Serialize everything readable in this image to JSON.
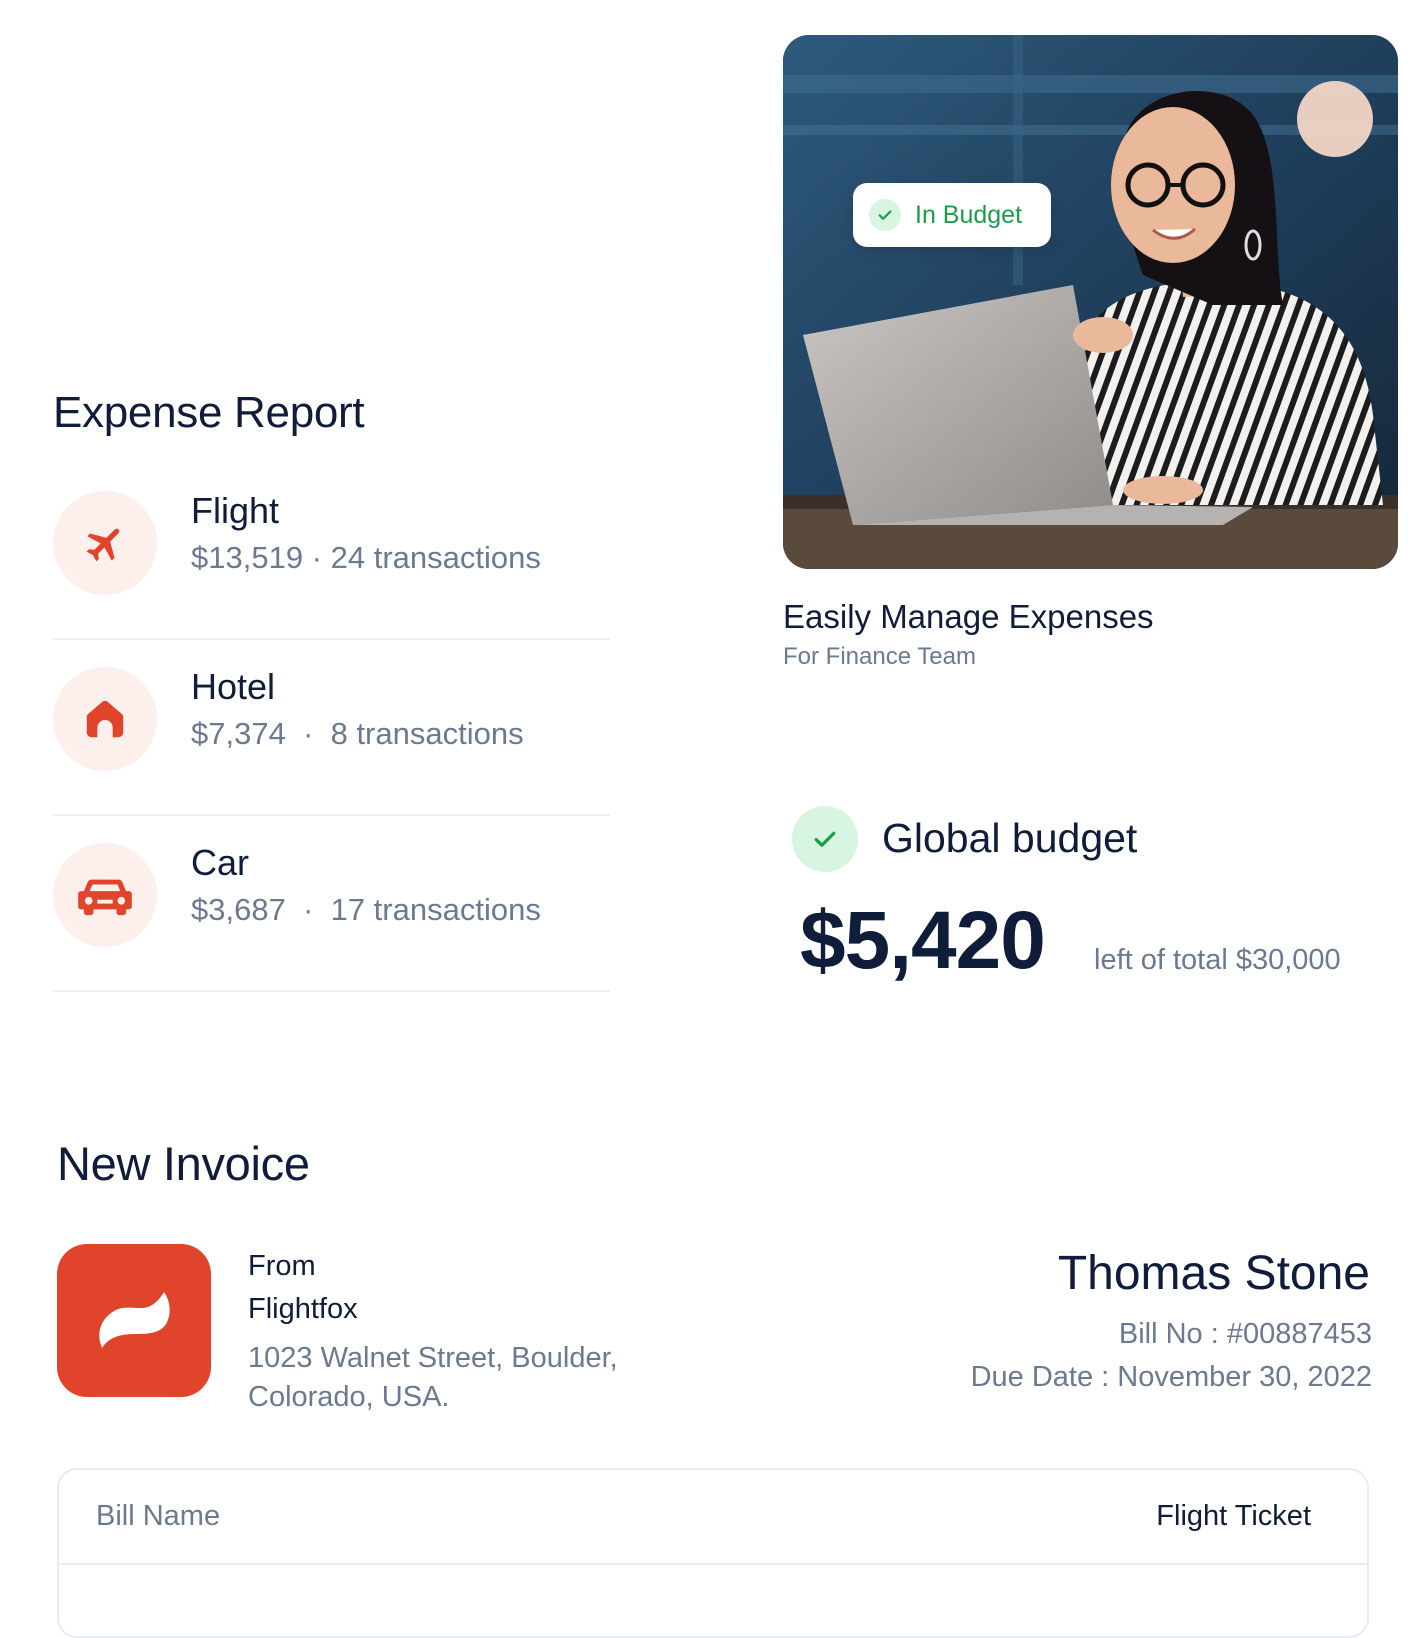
{
  "expense_report": {
    "title": "Expense Report",
    "items": [
      {
        "name": "Flight",
        "meta": "$13,519 · 24 transactions",
        "icon": "airplane-icon"
      },
      {
        "name": "Hotel",
        "meta": "$7,374  ·  8 transactions",
        "icon": "house-icon"
      },
      {
        "name": "Car",
        "meta": "$3,687  ·  17 transactions",
        "icon": "car-icon"
      }
    ],
    "accent_color": "#e0442a",
    "icon_bg_color": "#fdefec"
  },
  "promo_card": {
    "badge_label": "In Budget",
    "title": "Easily Manage Expenses",
    "subtitle": "For Finance Team"
  },
  "global_budget": {
    "title": "Global budget",
    "amount": "$5,420",
    "note": "left of total $30,000",
    "status_color": "#1c9d4b"
  },
  "invoice": {
    "title": "New Invoice",
    "from_label": "From",
    "company": "Flightfox",
    "address": "1023 Walnet Street, Boulder, Colorado, USA.",
    "recipient": "Thomas Stone",
    "bill_no": "Bill No : #00887453",
    "due_date": "Due Date : November 30, 2022",
    "table": {
      "rows": [
        {
          "label": "Bill Name",
          "value": "Flight Ticket"
        }
      ]
    }
  }
}
